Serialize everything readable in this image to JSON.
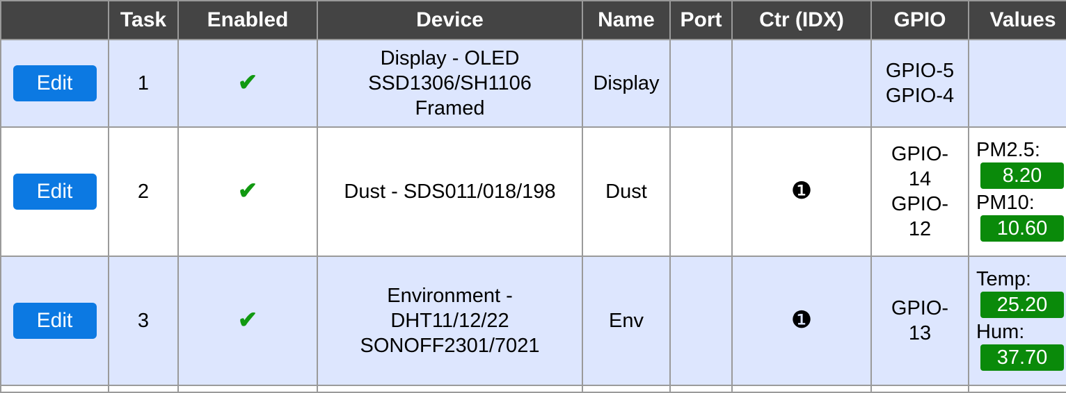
{
  "headers": [
    "",
    "Task",
    "Enabled",
    "Device",
    "Name",
    "Port",
    "Ctr (IDX)",
    "GPIO",
    "Values"
  ],
  "edit_label": "Edit",
  "check_glyph": "✔",
  "ctr_glyph": "❶",
  "colors": {
    "header_bg": "#444444",
    "row_odd_bg": "#dde6fe",
    "button_bg": "#0c79e2",
    "check": "#119911",
    "value_badge_bg": "#0a8a0a"
  },
  "rows": [
    {
      "task": "1",
      "device": [
        "Display - OLED",
        "SSD1306/SH1106",
        "Framed"
      ],
      "name": "Display",
      "port": "",
      "ctr": "",
      "gpio": [
        "GPIO-5",
        "GPIO-4"
      ],
      "values": []
    },
    {
      "task": "2",
      "device": [
        "Dust - SDS011/018/198"
      ],
      "name": "Dust",
      "port": "",
      "ctr": "❶",
      "gpio": [
        "GPIO-",
        "14",
        "GPIO-",
        "12"
      ],
      "values": [
        {
          "label": "PM2.5:",
          "value": "8.20"
        },
        {
          "label": "PM10:",
          "value": "10.60"
        }
      ]
    },
    {
      "task": "3",
      "device": [
        "Environment -",
        "DHT11/12/22",
        "SONOFF2301/7021"
      ],
      "name": "Env",
      "port": "",
      "ctr": "❶",
      "gpio": [
        "GPIO-",
        "13"
      ],
      "values": [
        {
          "label": "Temp:",
          "value": "25.20"
        },
        {
          "label": "Hum:",
          "value": "37.70"
        }
      ]
    }
  ]
}
